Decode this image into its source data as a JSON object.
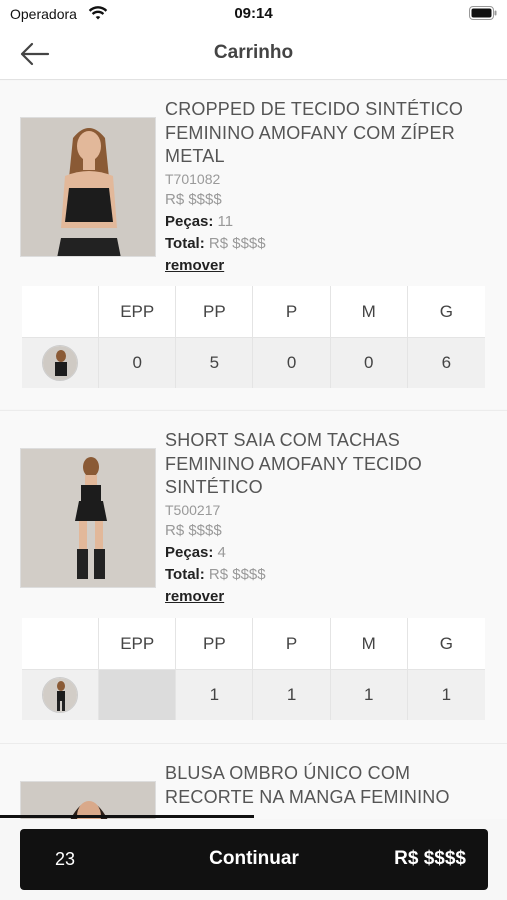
{
  "status": {
    "carrier": "Operadora",
    "time": "09:14"
  },
  "header": {
    "title": "Carrinho"
  },
  "products": [
    {
      "name": "CROPPED DE TECIDO SINTÉTICO FEMININO AMOFANY COM ZÍPER METAL",
      "sku": "T701082",
      "price": "R$ $$$$",
      "pieces_label": "Peças:",
      "pieces": "11",
      "total_label": "Total:",
      "total": "R$ $$$$",
      "remove": "remover",
      "sizes": [
        "EPP",
        "PP",
        "P",
        "M",
        "G"
      ],
      "quantities": [
        "0",
        "5",
        "0",
        "0",
        "6"
      ]
    },
    {
      "name": "SHORT SAIA COM TACHAS FEMININO AMOFANY TECIDO SINTÉTICO",
      "sku": "T500217",
      "price": "R$ $$$$",
      "pieces_label": "Peças:",
      "pieces": "4",
      "total_label": "Total:",
      "total": "R$ $$$$",
      "remove": "remover",
      "sizes": [
        "EPP",
        "PP",
        "P",
        "M",
        "G"
      ],
      "quantities": [
        "",
        "1",
        "1",
        "1",
        "1"
      ]
    },
    {
      "name": "BLUSA OMBRO ÚNICO COM RECORTE NA MANGA FEMININO"
    }
  ],
  "footer": {
    "count": "23",
    "cta": "Continuar",
    "total": "R$ $$$$"
  },
  "colors": {
    "accent": "#111111",
    "background": "#f7f7f7",
    "muted_text": "#999999"
  }
}
